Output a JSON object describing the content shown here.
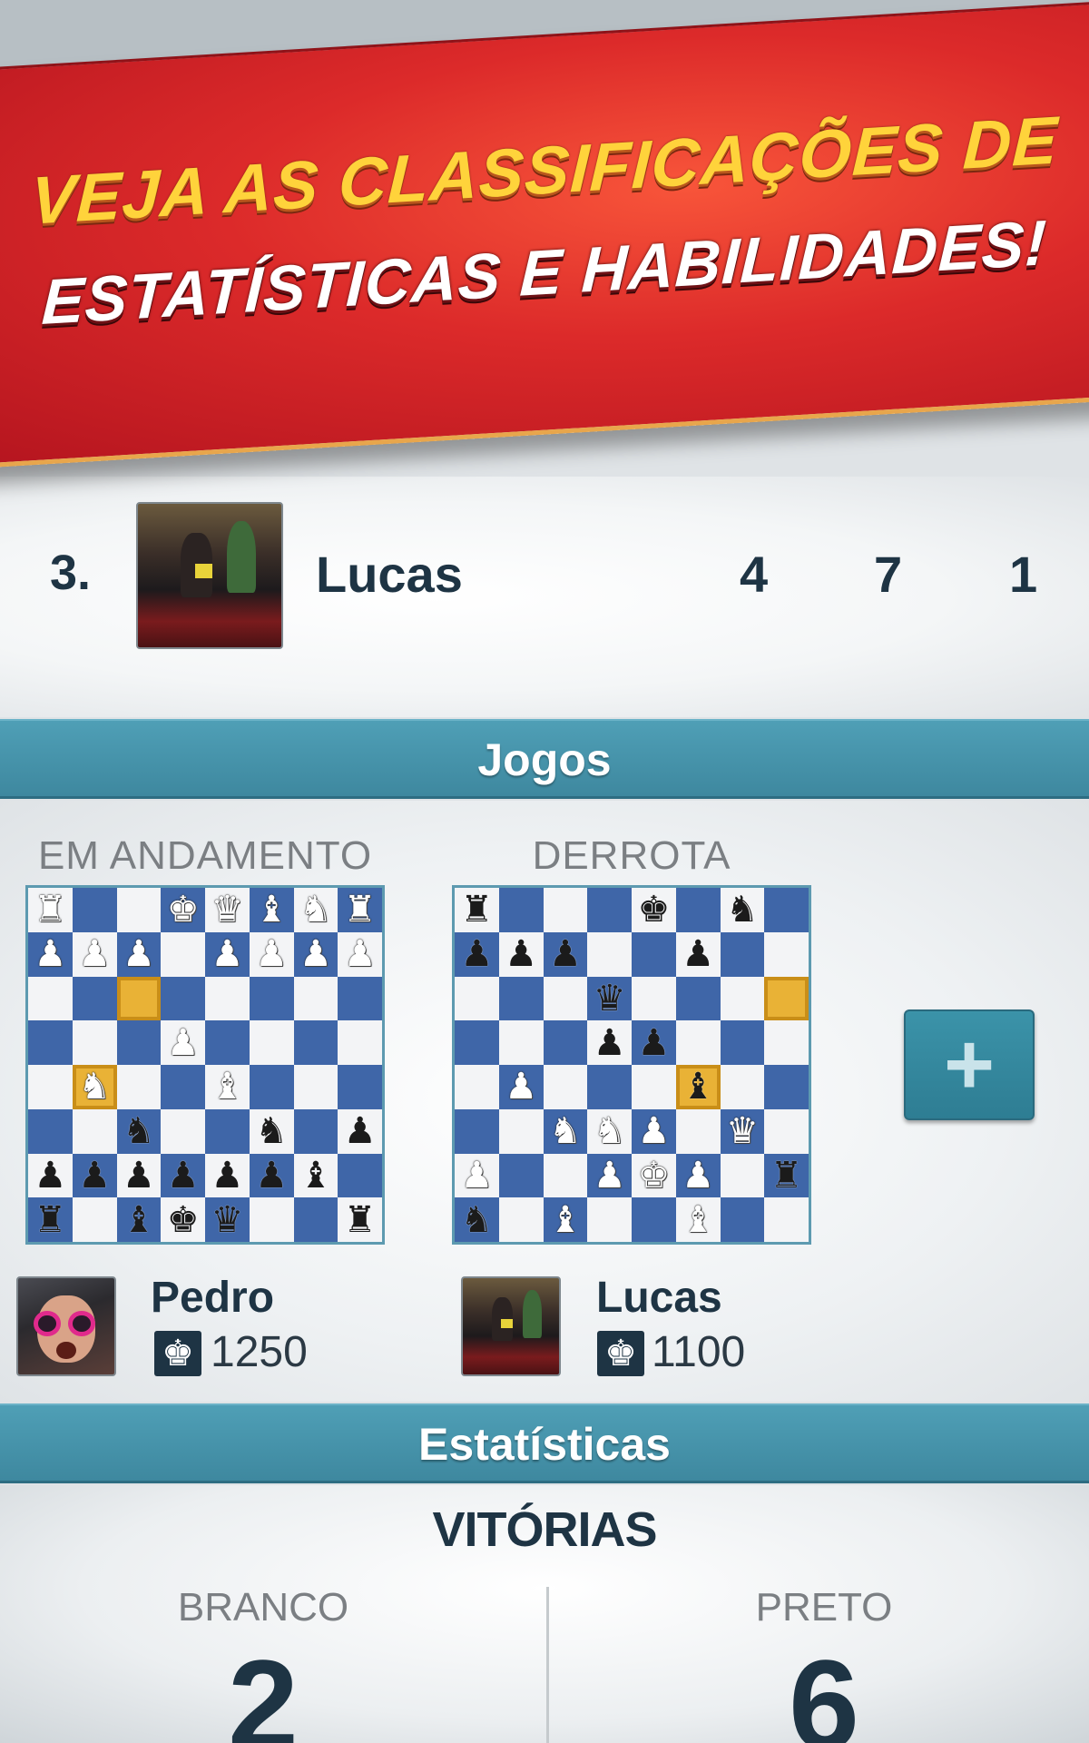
{
  "promo": {
    "line1": "VEJA AS CLASSIFICAÇÕES DE",
    "line2": "ESTATÍSTICAS E HABILIDADES!"
  },
  "ranking_row": {
    "position": "3.",
    "name": "Lucas",
    "stat_1": "4",
    "stat_2": "7",
    "stat_3": "1"
  },
  "games_section": {
    "title": "Jogos",
    "game_1": {
      "status": "EM ANDAMENTO",
      "player": "Pedro",
      "rating": "1250",
      "board": [
        [
          "wR",
          "",
          "",
          "wK",
          "wQ",
          "wB",
          "wN",
          "wR"
        ],
        [
          "wP",
          "wP",
          "wP",
          "",
          "wP",
          "wP",
          "wP",
          "wP"
        ],
        [
          "",
          "",
          "*",
          "",
          "",
          "",
          "",
          ""
        ],
        [
          "",
          "",
          "",
          "wP",
          "",
          "",
          "",
          ""
        ],
        [
          "",
          "*wN",
          "",
          "",
          "wB",
          "",
          "",
          ""
        ],
        [
          "",
          "",
          "bN",
          "",
          "",
          "bN",
          "",
          "bP"
        ],
        [
          "bP",
          "bP",
          "bP",
          "bP",
          "bP",
          "bP",
          "bB",
          ""
        ],
        [
          "bR",
          "",
          "bB",
          "bK",
          "bQ",
          "",
          "",
          "bR"
        ]
      ]
    },
    "game_2": {
      "status": "DERROTA",
      "player": "Lucas",
      "rating": "1100",
      "board": [
        [
          "bR",
          "",
          "",
          "",
          "bK",
          "",
          "bN",
          ""
        ],
        [
          "bP",
          "bP",
          "bP",
          "",
          "",
          "bP",
          "",
          ""
        ],
        [
          "",
          "",
          "",
          "bQ",
          "",
          "",
          "",
          "*"
        ],
        [
          "",
          "",
          "",
          "bP",
          "bP",
          "",
          "",
          ""
        ],
        [
          "",
          "wP",
          "",
          "",
          "",
          "*bB",
          "",
          ""
        ],
        [
          "",
          "",
          "wN",
          "wN",
          "wP",
          "",
          "wQ",
          ""
        ],
        [
          "wP",
          "",
          "",
          "wP",
          "wK",
          "wP",
          "",
          "bR"
        ],
        [
          "bN",
          "",
          "wB",
          "",
          "",
          "wB",
          "",
          ""
        ]
      ]
    },
    "add_button_label": "+"
  },
  "stats_section": {
    "title": "Estatísticas",
    "subtitle": "VITÓRIAS",
    "white_label": "BRANCO",
    "white_value": "2",
    "black_label": "PRETO",
    "black_value": "6"
  },
  "icons": [
    "plus-icon",
    "king-rating-icon"
  ]
}
